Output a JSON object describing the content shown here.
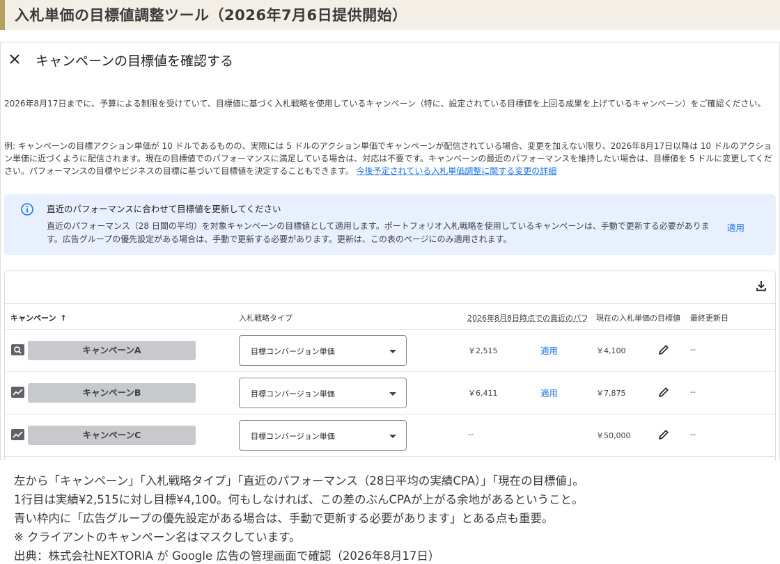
{
  "header": {
    "title": "入札単価の目標値調整ツール（2026年7月6日提供開始）"
  },
  "panel": {
    "title": "キャンペーンの目標値を確認する",
    "intro": "2026年8月17日までに、予算による制限を受けていて、目標値に基づく入札戦略を使用しているキャンペーン（特に、設定されている目標値を上回る成果を上げているキャンペーン）をご確認ください。",
    "example": "例: キャンペーンの目標アクション単価が 10 ドルであるものの、実際には 5 ドルのアクション単価でキャンペーンが配信されている場合、変更を加えない限り、2026年8月17日以降は 10 ドルのアクション単価に近づくように配信されます。現在の目標値でのパフォーマンスに満足している場合は、対応は不要です。キャンペーンの最近のパフォーマンスを維持したい場合は、目標値を 5 ドルに変更してください。パフォーマンスの目標やビジネスの目標に基づいて目標値を決定することもできます。",
    "link": "今後予定されている入札単価調整に関する変更の詳細",
    "info": {
      "title": "直近のパフォーマンスに合わせて目標値を更新してください",
      "body": "直近のパフォーマンス（28 日間の平均）を対象キャンペーンの目標値として適用します。ポートフォリオ入札戦略を使用しているキャンペーンは、手動で更新する必要があります。広告グループの優先設定がある場合は、手動で更新する必要があります。更新は、この表のページにのみ適用されます。",
      "apply": "適用"
    }
  },
  "table": {
    "headers": {
      "campaign": "キャンペーン",
      "strategy": "入札戦略タイプ",
      "performance": "2026年8月8日時点での直近のパフ",
      "target": "現在の入札単価の目標値",
      "updated": "最終更新日"
    },
    "rows": [
      {
        "icon": "search-icon",
        "campaign": "キャンペーンA",
        "strategy": "目標コンバージョン単価",
        "performance": "￥2,515",
        "apply": "適用",
        "target": "￥4,100",
        "updated": "--"
      },
      {
        "icon": "trend-icon",
        "campaign": "キャンペーンB",
        "strategy": "目標コンバージョン単価",
        "performance": "￥6,411",
        "apply": "適用",
        "target": "￥7,875",
        "updated": "--"
      },
      {
        "icon": "trend-icon",
        "campaign": "キャンペーンC",
        "strategy": "目標コンバージョン単価",
        "performance": "--",
        "apply": "",
        "target": "￥50,000",
        "updated": "--"
      }
    ]
  },
  "caption": {
    "lines": [
      "左から「キャンペーン」「入札戦略タイプ」「直近のパフォーマンス（28日平均の実績CPA）」「現在の目標値」。",
      "1行目は実績¥2,515に対し目標¥4,100。何もしなければ、この差のぶんCPAが上がる余地があるということ。",
      "青い枠内に「広告グループの優先設定がある場合は、手動で更新する必要があります」とある点も重要。",
      "※ クライアントのキャンペーン名はマスクしています。",
      "出典：株式会社NEXTORIA が Google 広告の管理画面で確認（2026年8月17日）"
    ]
  },
  "colors": {
    "accent_bar": "#b8a065",
    "link_blue": "#1a73e8",
    "info_bg": "#e8f0fe"
  }
}
